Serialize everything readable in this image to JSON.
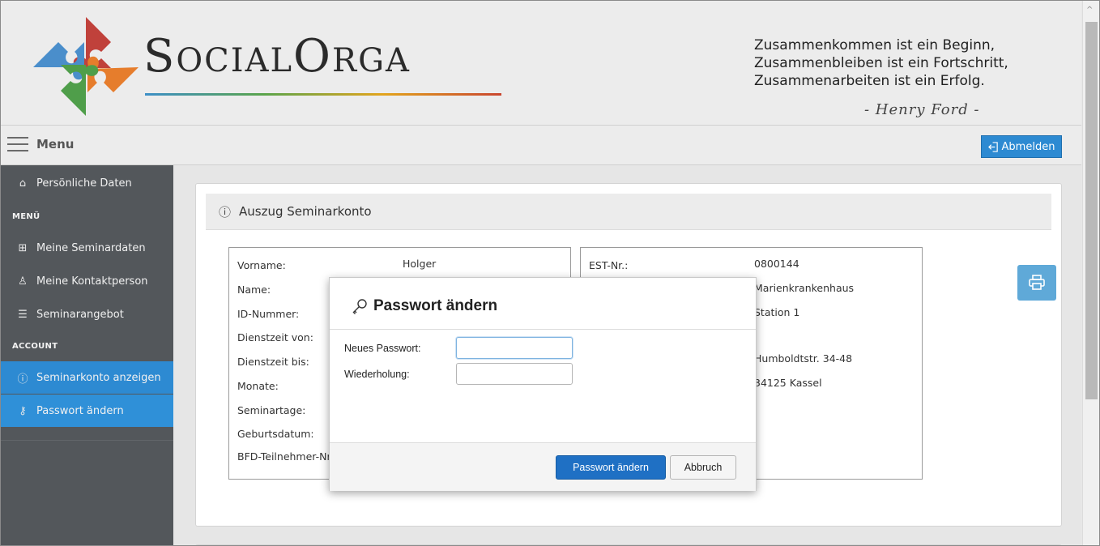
{
  "header": {
    "brand_first": "S",
    "brand_rest1": "OCIAL",
    "brand_mid": "O",
    "brand_rest2": "RGA",
    "quote_lines": [
      "Zusammenkommen ist ein Beginn,",
      "Zusammenbleiben ist ein Fortschritt,",
      "Zusammenarbeiten ist ein Erfolg."
    ],
    "quote_author": "- Henry Ford -"
  },
  "menubar": {
    "menu_label": "Menu",
    "logout_label": "Abmelden"
  },
  "sidebar": {
    "personal": "Persönliche Daten",
    "section_menu": "MENÜ",
    "seminardaten": "Meine Seminardaten",
    "kontaktperson": "Meine Kontaktperson",
    "seminarangebot": "Seminarangebot",
    "section_account": "ACCOUNT",
    "seminarkonto": "Seminarkonto anzeigen",
    "passwort": "Passwort ändern"
  },
  "panel": {
    "title": "Auszug Seminarkonto",
    "left_labels": [
      "Vorname:",
      "Name:",
      "ID-Nummer:",
      "Dienstzeit von:",
      "Dienstzeit bis:",
      "Monate:",
      "Seminartage:",
      "Geburtsdatum:",
      "BFD-Teilnehmer-Nr"
    ],
    "left_values": [
      "Holger"
    ],
    "right_labels": [
      "EST-Nr.:"
    ],
    "right_values": [
      "0800144",
      "Marienkrankenhaus",
      "Station 1",
      "Humboldtstr. 34-48",
      "34125 Kassel"
    ]
  },
  "modal": {
    "title": "Passwort ändern",
    "new_password_label": "Neues Passwort:",
    "repeat_label": "Wiederholung:",
    "new_password_value": "",
    "repeat_value": "",
    "submit_label": "Passwort ändern",
    "cancel_label": "Abbruch"
  },
  "colors": {
    "accent": "#2d8ad2",
    "sidebar_bg": "#53575b",
    "primary_button": "#1f70c4"
  }
}
